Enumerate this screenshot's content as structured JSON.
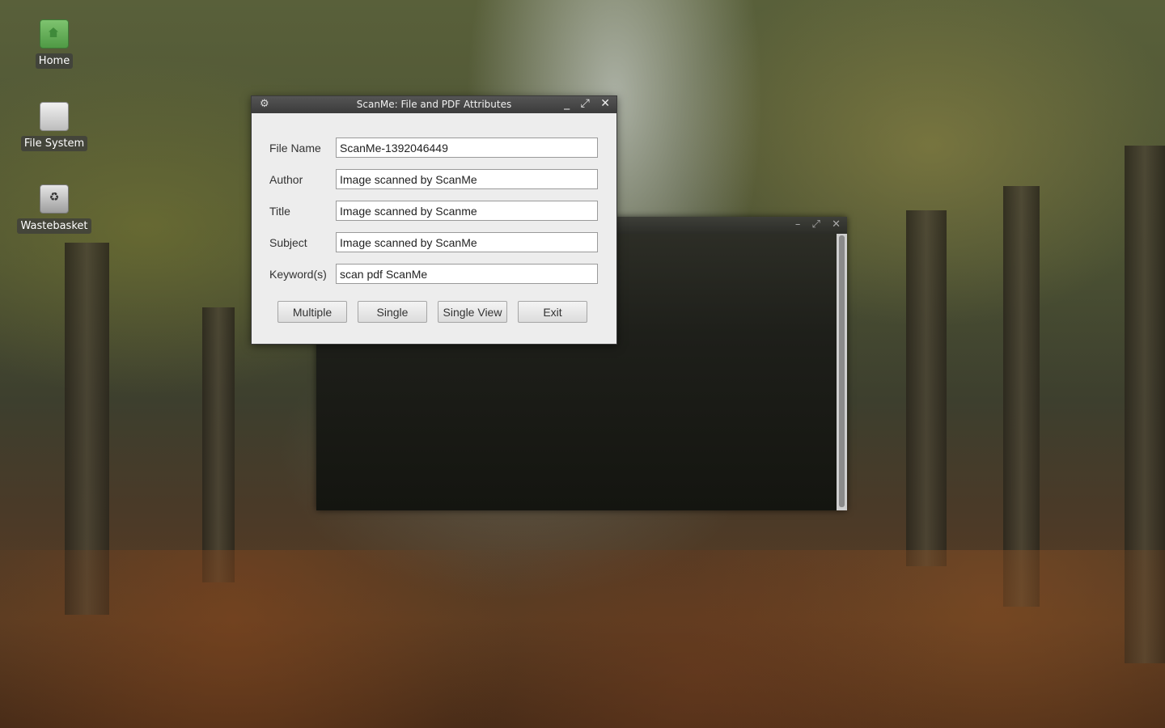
{
  "desktop": {
    "icons": [
      {
        "label": "Home",
        "icon": "home-folder-icon"
      },
      {
        "label": "File System",
        "icon": "drive-icon"
      },
      {
        "label": "Wastebasket",
        "icon": "trash-icon"
      }
    ]
  },
  "background_window": {
    "controls": {
      "minimize": "–",
      "maximize": "⤢",
      "close": "✕"
    }
  },
  "dialog": {
    "title": "ScanMe: File and PDF Attributes",
    "menu_glyph": "⚙",
    "controls": {
      "minimize": "_",
      "maximize": "⤢",
      "close": "✕"
    },
    "fields": [
      {
        "label": "File Name",
        "value": "ScanMe-1392046449"
      },
      {
        "label": "Author",
        "value": "Image scanned by ScanMe"
      },
      {
        "label": "Title",
        "value": "Image scanned by Scanme"
      },
      {
        "label": "Subject",
        "value": "Image scanned by ScanMe"
      },
      {
        "label": "Keyword(s)",
        "value": "scan pdf ScanMe"
      }
    ],
    "buttons": {
      "multiple": "Multiple",
      "single": "Single",
      "single_view": "Single View",
      "exit": "Exit"
    }
  }
}
